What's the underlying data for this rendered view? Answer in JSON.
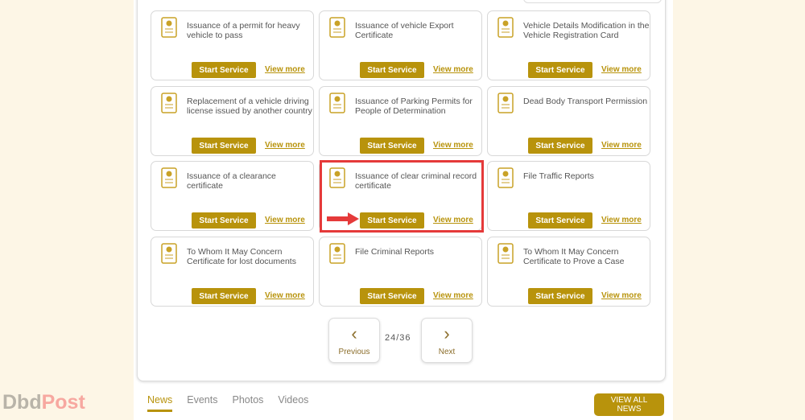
{
  "services": [
    {
      "title": "Issuance of a permit for heavy vehicle to pass",
      "icon": "truck-permit-icon"
    },
    {
      "title": "Issuance of vehicle Export Certificate",
      "icon": "car-certificate-icon"
    },
    {
      "title": "Vehicle Details Modification in the Vehicle Registration Card",
      "icon": "car-info-icon"
    },
    {
      "title": "Replacement of a vehicle driving license issued by another country",
      "icon": "license-exchange-icon"
    },
    {
      "title": "Issuance of Parking Permits for People of Determination",
      "icon": "accessible-parking-icon"
    },
    {
      "title": "Dead Body Transport Permission",
      "icon": "ambulance-icon"
    },
    {
      "title": "Issuance of a clearance certificate",
      "icon": "clearance-certificate-icon"
    },
    {
      "title": "Issuance of clear criminal record certificate",
      "icon": "criminal-record-certificate-icon"
    },
    {
      "title": "File Traffic Reports",
      "icon": "report-laptop-icon"
    },
    {
      "title": "To Whom It May Concern Certificate for lost documents",
      "icon": "lost-document-icon"
    },
    {
      "title": "File Criminal Reports",
      "icon": "masked-criminal-icon"
    },
    {
      "title": "To Whom It May Concern Certificate to Prove a Case",
      "icon": "report-laptop-icon"
    }
  ],
  "labels": {
    "start": "Start Service",
    "view": "View more"
  },
  "pager": {
    "prev": "Previous",
    "next": "Next",
    "count": "24/36",
    "prev_icon": "‹",
    "next_icon": "›"
  },
  "tabs": [
    "News",
    "Events",
    "Photos",
    "Videos"
  ],
  "view_all": "VIEW ALL NEWS",
  "logo": {
    "part1": "Dbd",
    "part2": "Post"
  },
  "colors": {
    "accent": "#b8930c",
    "highlight": "#e53a3a"
  }
}
